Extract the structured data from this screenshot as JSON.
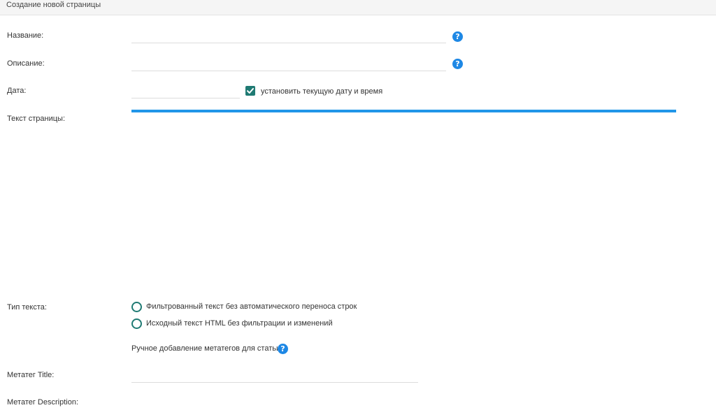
{
  "header": {
    "title": "Создание новой страницы"
  },
  "fields": {
    "name": {
      "label": "Название:",
      "value": ""
    },
    "description": {
      "label": "Описание:",
      "value": ""
    },
    "date": {
      "label": "Дата:",
      "value": "",
      "checkbox_label": "установить текущую дату и время",
      "checkbox_checked": true
    },
    "page_text": {
      "label": "Текст страницы:"
    },
    "text_type": {
      "label": "Тип текста:",
      "options": [
        {
          "label": "Фильтрованный текст без автоматического переноса строк",
          "selected": false
        },
        {
          "label": "Исходный текст HTML без фильтрации и изменений",
          "selected": false
        }
      ]
    },
    "meta_manual": {
      "label": "Ручное добавление метатегов для статьи"
    },
    "meta_title": {
      "label": "Метатег Title:",
      "value": ""
    },
    "meta_description": {
      "label": "Метатег Description:"
    }
  },
  "colors": {
    "accent": "#1e88e5",
    "editor_bar": "#2196e8",
    "control": "#1f7a73"
  },
  "icons": {
    "help": "question-circle-icon",
    "check": "checkmark-icon"
  }
}
